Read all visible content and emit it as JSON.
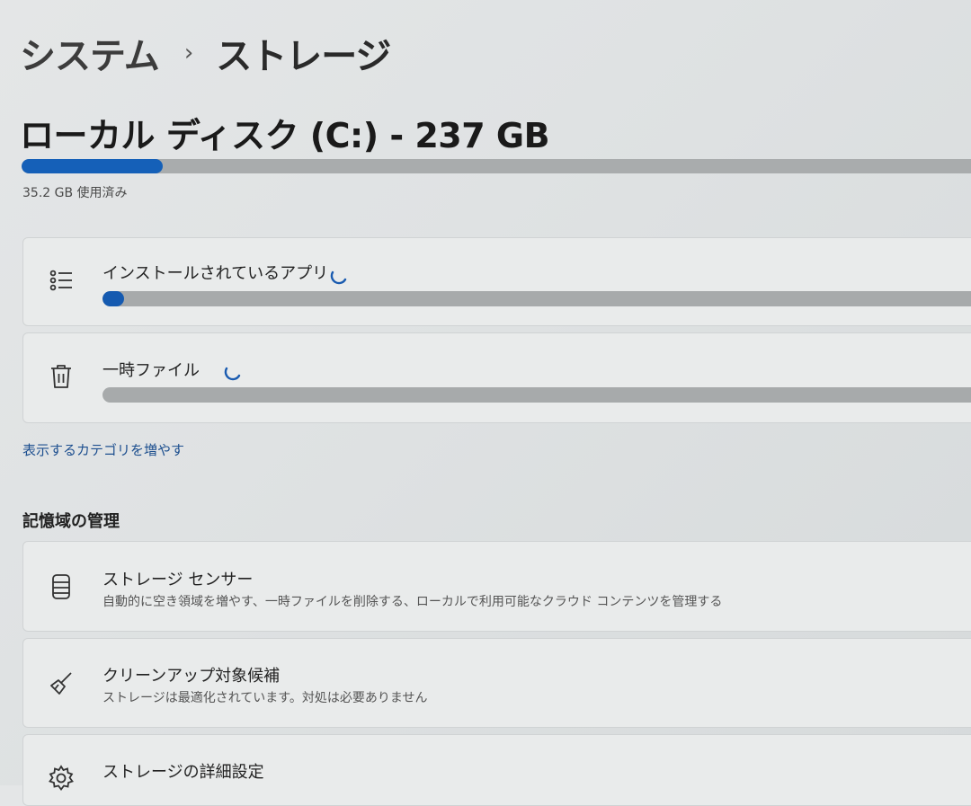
{
  "breadcrumb": {
    "parent": "システム",
    "separator": "›",
    "current": "ストレージ"
  },
  "disk": {
    "title": "ローカル ディスク (C:) - 237 GB",
    "used_text": "35.2 GB 使用済み",
    "used_fraction": 0.1485
  },
  "categories": [
    {
      "label": "インストールされているアプリ",
      "icon": "list-icon",
      "fill_fraction": 0.02,
      "loading": true
    },
    {
      "label": "一時ファイル",
      "icon": "trash-icon",
      "fill_fraction": 0,
      "loading": true
    }
  ],
  "show_more_link": "表示するカテゴリを増やす",
  "management": {
    "title": "記憶域の管理",
    "items": [
      {
        "label": "ストレージ センサー",
        "description": "自動的に空き領域を増やす、一時ファイルを削除する、ローカルで利用可能なクラウド コンテンツを管理する",
        "icon": "storage-sense-icon"
      },
      {
        "label": "クリーンアップ対象候補",
        "description": "ストレージは最適化されています。対処は必要ありません",
        "icon": "broom-icon"
      },
      {
        "label": "ストレージの詳細設定",
        "description": "",
        "icon": "gear-icon"
      }
    ]
  },
  "colors": {
    "accent": "#1560b8",
    "bar_track": "#a9acad",
    "link": "#1d4f8f"
  }
}
